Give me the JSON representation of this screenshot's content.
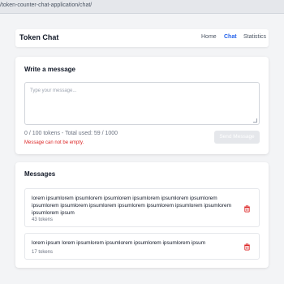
{
  "browser": {
    "url": "/token-counter-chat-application/chat/"
  },
  "nav": {
    "brand": "Token Chat",
    "links": [
      {
        "label": "Home",
        "active": false
      },
      {
        "label": "Chat",
        "active": true
      },
      {
        "label": "Statistics",
        "active": false
      }
    ]
  },
  "composer": {
    "title": "Write a message",
    "placeholder": "Type your message...",
    "counter": "0 / 100 tokens - Total used: 59 / 1000",
    "error": "Message can not be empty.",
    "send_label": "Send Message"
  },
  "messages": {
    "title": "Messages",
    "items": [
      {
        "text": "lorem ipsumlorem ipsumlorem ipsumlorem ipsumlorem ipsumlorem ipsumlorem ipsumlorem ipsumlorem ipsumlorem ipsumlorem ipsumlorem ipsumlorem ipsumlorem ipsumlorem ipsum",
        "tokens": "43 tokens"
      },
      {
        "text": "lorem ipsum lorem ipsumlorem ipsumlorem ipsumlorem ipsumlorem ipsum",
        "tokens": "17 tokens"
      }
    ]
  },
  "colors": {
    "accent": "#2563eb",
    "error": "#dc2626",
    "delete": "#dc2626"
  },
  "icons": {
    "delete": "trash-icon"
  }
}
